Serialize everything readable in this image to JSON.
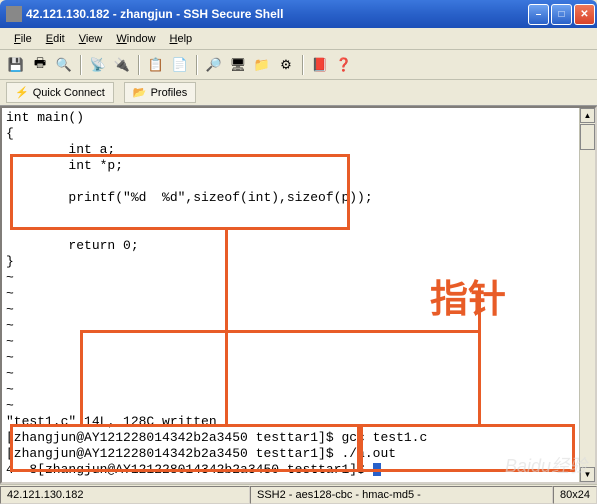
{
  "title": "42.121.130.182 - zhangjun - SSH Secure Shell",
  "menus": {
    "file": "File",
    "edit": "Edit",
    "view": "View",
    "window": "Window",
    "help": "Help"
  },
  "conn": {
    "quick": "Quick Connect",
    "profiles": "Profiles"
  },
  "code": {
    "l1": "int main()",
    "l2": "{",
    "l3": "        int a;",
    "l4": "        int *p;",
    "l5": "",
    "l6": "        printf(\"%d  %d\",sizeof(int),sizeof(p));",
    "l7": "",
    "l8": "",
    "l9": "        return 0;",
    "l10": "}",
    "tilde": "~",
    "w1": "\"test1.c\" 14L, 128C written",
    "w2": "[zhangjun@AY121228014342b2a3450 testtar1]$ gcc test1.c",
    "w3": "[zhangjun@AY121228014342b2a3450 testtar1]$ ./a.out",
    "w4": "4  8[zhangjun@AY121228014342b2a3450 testtar1]$ "
  },
  "status": {
    "left": "       42.121.130.182",
    "mid": "SSH2 - aes128-cbc - hmac-md5 - ",
    "rc": "80x24"
  },
  "hand": "指针",
  "watermark": "Baidu经验"
}
